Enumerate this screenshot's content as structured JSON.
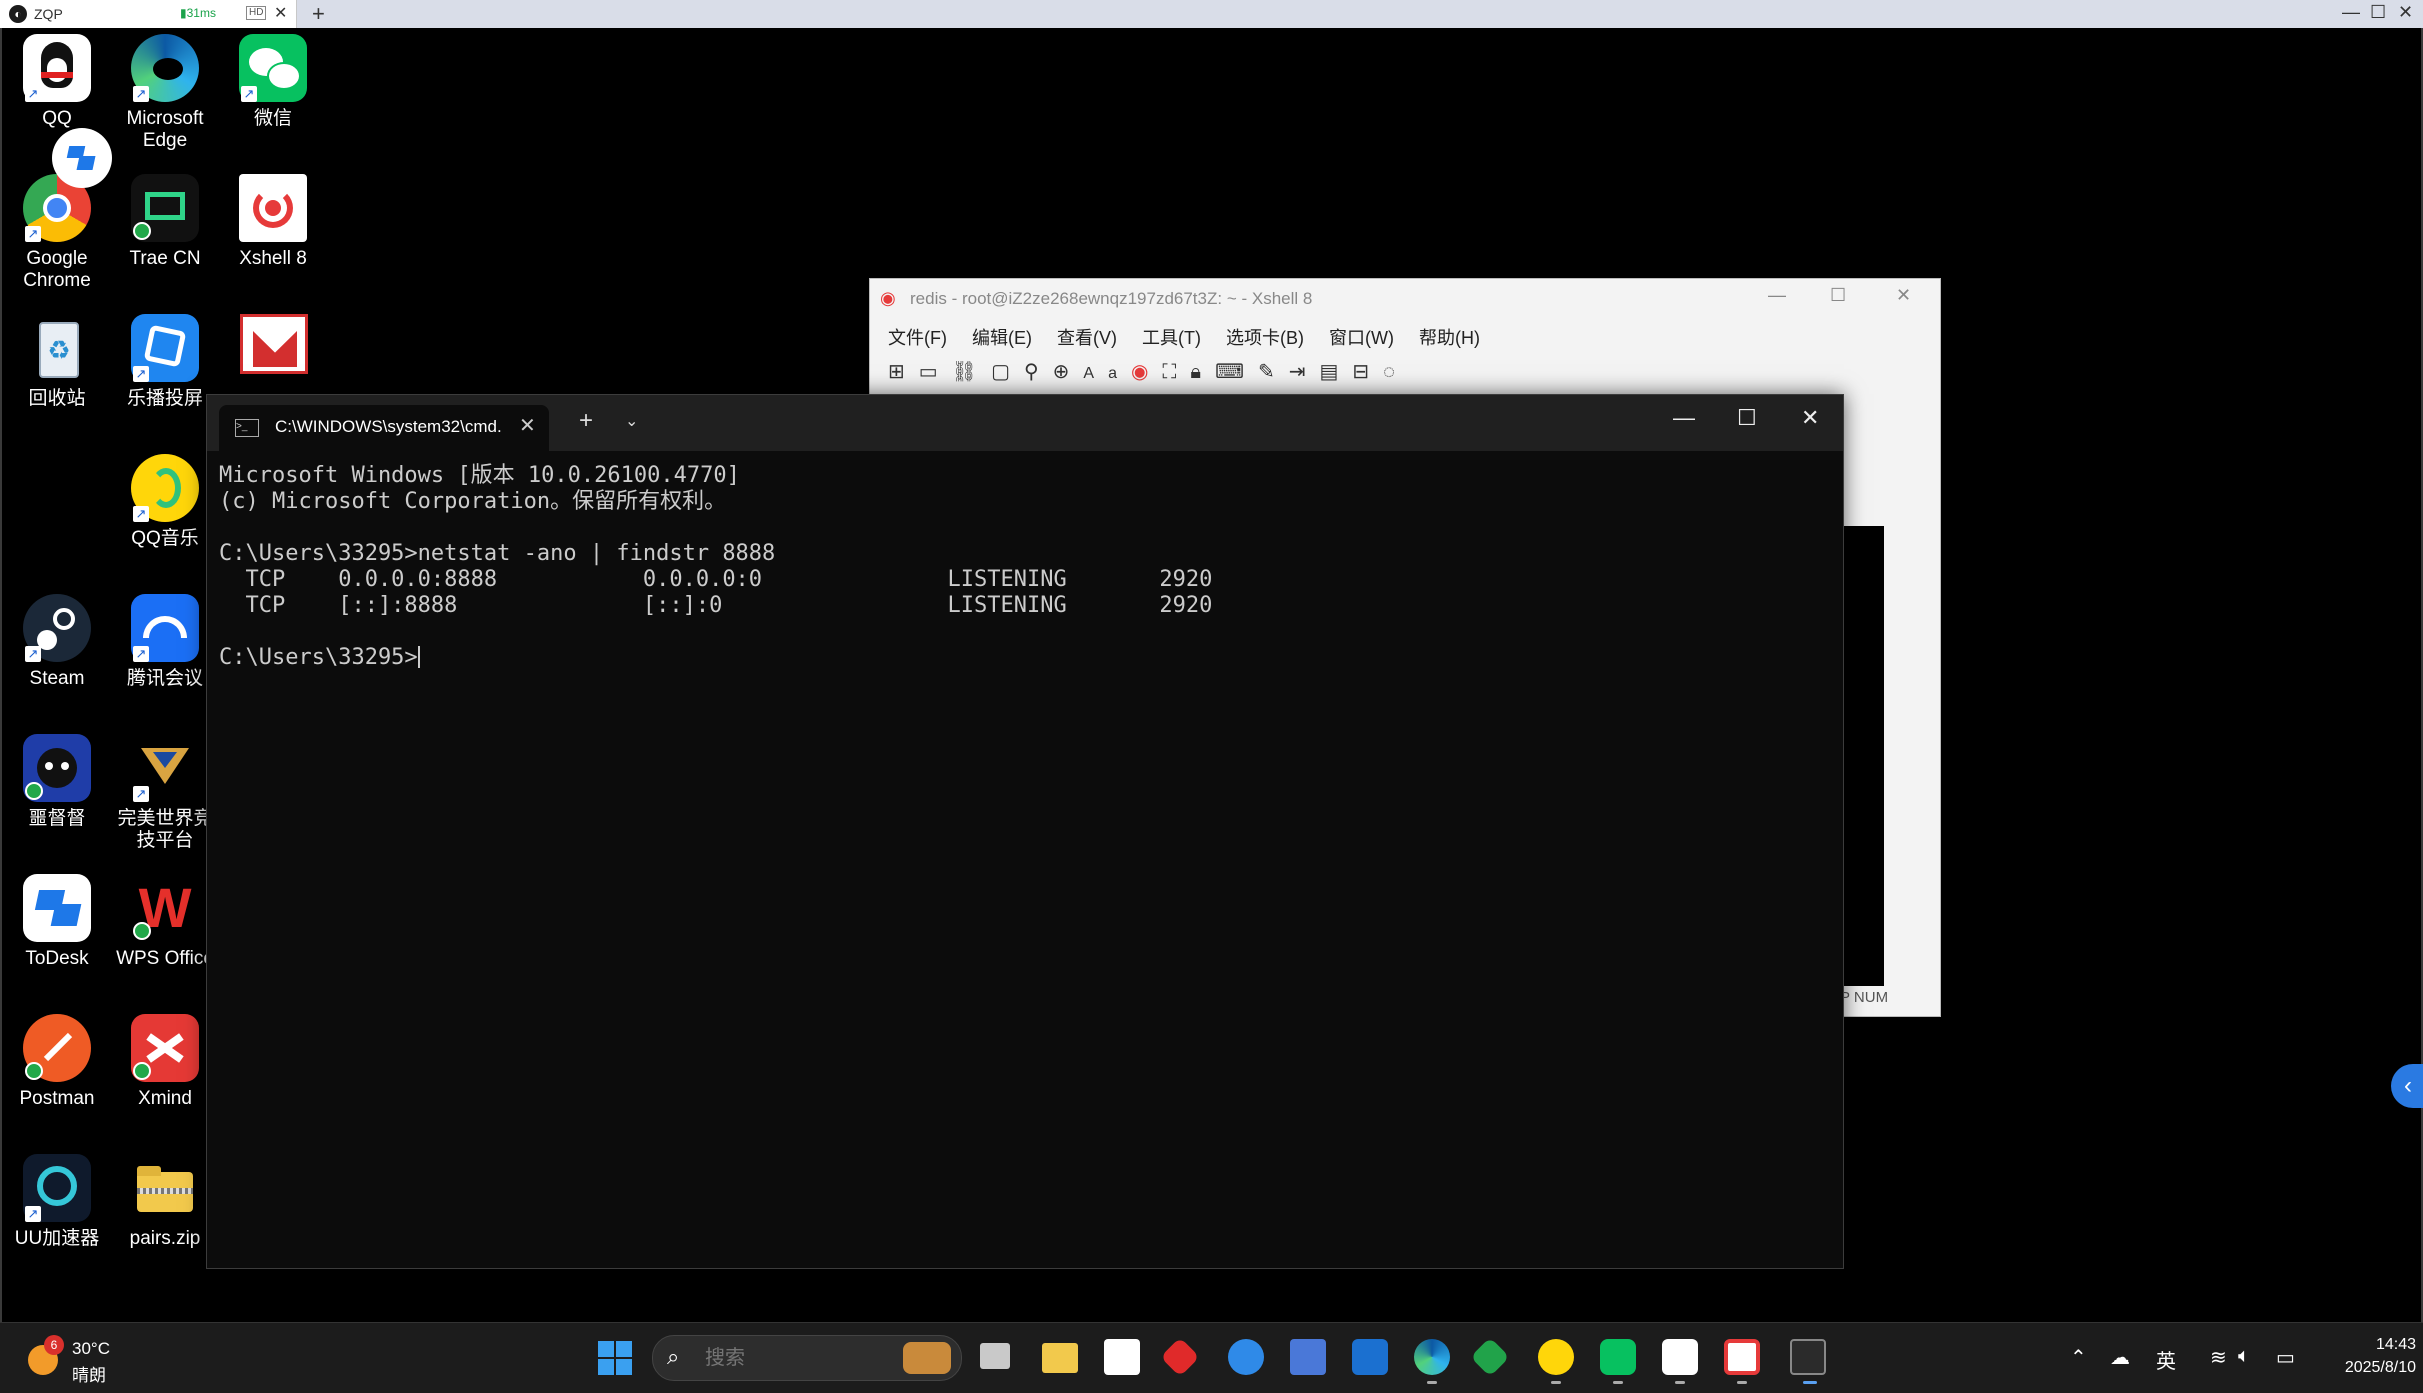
{
  "remote_session": {
    "tab_title": "ZQP",
    "latency": "31ms",
    "quality_badge": "HD",
    "close_tab": "✕",
    "new_tab": "+",
    "window_controls": [
      "—",
      "☐",
      "✕"
    ]
  },
  "desktop_icons": [
    {
      "label": "QQ",
      "icon": "qq-icon"
    },
    {
      "label": "Microsoft Edge",
      "icon": "edge-icon"
    },
    {
      "label": "微信",
      "icon": "wechat-icon"
    },
    {
      "label": "Google Chrome",
      "icon": "chrome-icon"
    },
    {
      "label": "Trae CN",
      "icon": "trae-icon"
    },
    {
      "label": "Xshell 8",
      "icon": "xshell-icon"
    },
    {
      "label": "回收站",
      "icon": "recycle-bin-icon"
    },
    {
      "label": "乐播投屏",
      "icon": "lebo-cast-icon"
    },
    {
      "label": "QQ音乐",
      "icon": "qq-music-icon"
    },
    {
      "label": "Steam",
      "icon": "steam-icon"
    },
    {
      "label": "腾讯会议",
      "icon": "tencent-meeting-icon"
    },
    {
      "label": "噩督督",
      "icon": "cat-app-icon"
    },
    {
      "label": "完美世界竞技平台",
      "icon": "perfect-world-icon"
    },
    {
      "label": "ToDesk",
      "icon": "todesk-icon"
    },
    {
      "label": "WPS Office",
      "icon": "wps-icon"
    },
    {
      "label": "Postman",
      "icon": "postman-icon"
    },
    {
      "label": "Xmind",
      "icon": "xmind-icon"
    },
    {
      "label": "UU加速器",
      "icon": "uu-accelerator-icon"
    },
    {
      "label": "pairs.zip",
      "icon": "zip-folder-icon"
    }
  ],
  "xshell": {
    "title": "redis - root@iZ2ze268ewnqz197zd67t3Z: ~ - Xshell 8",
    "menu": [
      "文件(F)",
      "编辑(E)",
      "查看(V)",
      "工具(T)",
      "选项卡(B)",
      "窗口(W)",
      "帮助(H)"
    ],
    "font_button": "Aa",
    "status_text": "P   NUM",
    "window_controls": [
      "—",
      "☐",
      "✕"
    ]
  },
  "cmd": {
    "tab_title": "C:\\WINDOWS\\system32\\cmd.",
    "tab_close": "✕",
    "new_tab": "+",
    "dropdown": "⌄",
    "window_controls": [
      "—",
      "☐",
      "✕"
    ],
    "output": "Microsoft Windows [版本 10.0.26100.4770]\n(c) Microsoft Corporation。保留所有权利。\n\nC:\\Users\\33295>netstat -ano | findstr 8888\n  TCP    0.0.0.0:8888           0.0.0.0:0              LISTENING       2920\n  TCP    [::]:8888              [::]:0                 LISTENING       2920\n\nC:\\Users\\33295>"
  },
  "taskbar": {
    "weather_badge": "6",
    "temperature": "30°C",
    "condition": "晴朗",
    "search_placeholder": "搜索",
    "apps": [
      "task-view-icon",
      "file-explorer-icon",
      "microsoft-store-icon",
      "red-diamond-app-icon",
      "qq-browser-icon",
      "blue-box-app-icon",
      "outlook-icon",
      "edge-icon",
      "green-diamond-app-icon",
      "qq-music-icon",
      "wechat-icon",
      "todesk-icon",
      "xshell-icon",
      "terminal-icon"
    ],
    "ime": "英",
    "time": "14:43",
    "date": "2025/8/10"
  },
  "colors": {
    "taskbar": "#1c1c1c",
    "terminal_bg": "#0c0c0c",
    "accent": "#2a7ae2"
  }
}
